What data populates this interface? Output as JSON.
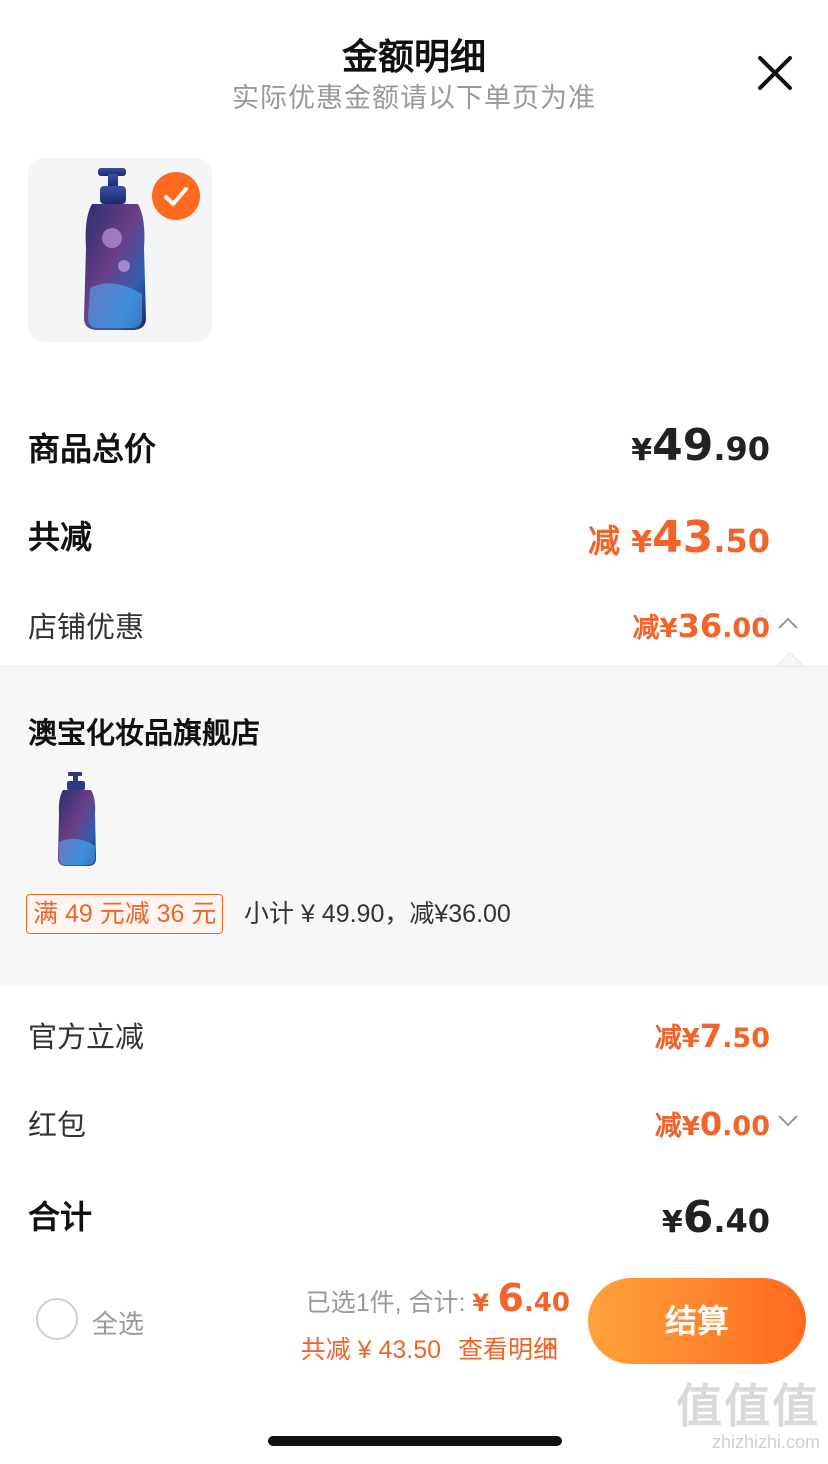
{
  "header": {
    "title": "金额明细",
    "subtitle": "实际优惠金额请以下单页为准"
  },
  "summary": {
    "total_label": "商品总价",
    "total_currency": "¥",
    "total_int": "49",
    "total_dec": ".90",
    "discount_label": "共减",
    "discount_prefix": "减 ",
    "discount_currency": "¥",
    "discount_int": "43",
    "discount_dec": ".50"
  },
  "store_discount": {
    "label": "店铺优惠",
    "prefix": "减",
    "currency": "¥",
    "int": "36",
    "dec": ".00"
  },
  "store": {
    "name": "澳宝化妆品旗舰店",
    "promo_tag": "满 49 元减 36 元",
    "promo_subtotal": "小计 ¥ 49.90，减¥36.00"
  },
  "official": {
    "label": "官方立减",
    "prefix": "减",
    "currency": "¥",
    "int": "7",
    "dec": ".50"
  },
  "red_packet": {
    "label": "红包",
    "prefix": "减",
    "currency": "¥",
    "int": "0",
    "dec": ".00"
  },
  "grand_total": {
    "label": "合计",
    "currency": "¥",
    "int": "6",
    "dec": ".40"
  },
  "bottom_bar": {
    "select_all": "全选",
    "selected_text": "已选1件, 合计: ",
    "amount_currency": "¥ ",
    "amount_int": "6",
    "amount_dec": ".40",
    "discount_text": "共减 ¥ 43.50",
    "detail_link": "查看明细",
    "checkout": "结算"
  },
  "watermark": {
    "big": "值值值",
    "small": "zhizhizhi.com"
  },
  "colors": {
    "accent": "#f2642a",
    "checkout_start": "#ffa33c",
    "checkout_end": "#ff6a1f"
  },
  "icons": [
    "close-icon",
    "check-icon",
    "chevron-up-icon",
    "chevron-down-icon"
  ]
}
